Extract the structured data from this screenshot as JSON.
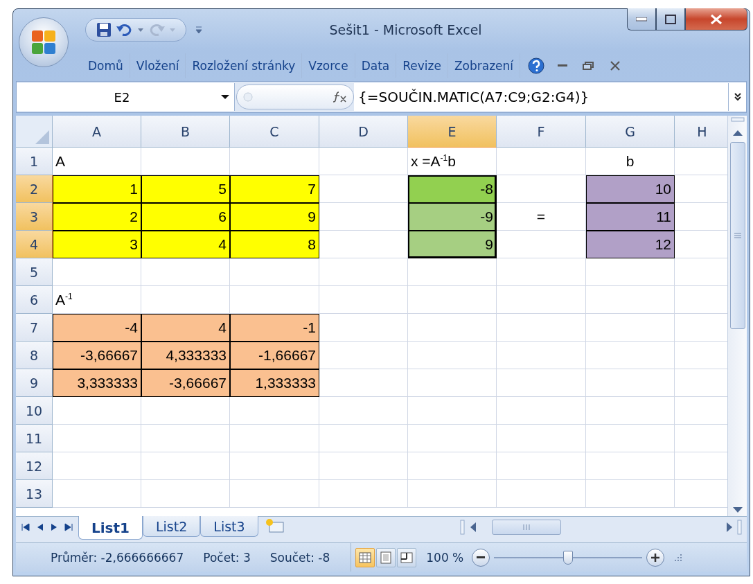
{
  "window": {
    "title": "Sešit1  -  Microsoft Excel"
  },
  "ribbon_tabs": [
    "Domů",
    "Vložení",
    "Rozložení stránky",
    "Vzorce",
    "Data",
    "Revize",
    "Zobrazení"
  ],
  "formula_bar": {
    "name_box": "E2",
    "formula": "{=SOUČIN.MATIC(A7:C9;G2:G4)}"
  },
  "columns": [
    {
      "label": "A",
      "selected": false
    },
    {
      "label": "B",
      "selected": false
    },
    {
      "label": "C",
      "selected": false
    },
    {
      "label": "D",
      "selected": false
    },
    {
      "label": "E",
      "selected": true
    },
    {
      "label": "F",
      "selected": false
    },
    {
      "label": "G",
      "selected": false
    },
    {
      "label": "H",
      "selected": false
    }
  ],
  "rows": [
    {
      "label": "1",
      "selected": false,
      "cells": [
        {
          "text": "A",
          "kind": "text"
        },
        null,
        null,
        null,
        {
          "text": "x =A$^{-1}$b",
          "kind": "text"
        },
        null,
        {
          "text": "b",
          "kind": "centered"
        },
        null
      ]
    },
    {
      "label": "2",
      "selected": true,
      "cells": [
        {
          "text": "1",
          "kind": "number",
          "color": "#ffff00"
        },
        {
          "text": "5",
          "kind": "number",
          "color": "#ffff00"
        },
        {
          "text": "7",
          "kind": "number",
          "color": "#ffff00"
        },
        null,
        {
          "text": "-8",
          "kind": "number",
          "color": "#92d050"
        },
        null,
        {
          "text": "10",
          "kind": "number",
          "color": "#b1a0c7"
        },
        null
      ]
    },
    {
      "label": "3",
      "selected": true,
      "cells": [
        {
          "text": "2",
          "kind": "number",
          "color": "#ffff00"
        },
        {
          "text": "6",
          "kind": "number",
          "color": "#ffff00"
        },
        {
          "text": "9",
          "kind": "number",
          "color": "#ffff00"
        },
        null,
        {
          "text": "-9",
          "kind": "number",
          "color": "#a6cf82"
        },
        {
          "text": "=",
          "kind": "centered"
        },
        {
          "text": "11",
          "kind": "number",
          "color": "#b1a0c7"
        },
        null
      ]
    },
    {
      "label": "4",
      "selected": true,
      "cells": [
        {
          "text": "3",
          "kind": "number",
          "color": "#ffff00"
        },
        {
          "text": "4",
          "kind": "number",
          "color": "#ffff00"
        },
        {
          "text": "8",
          "kind": "number",
          "color": "#ffff00"
        },
        null,
        {
          "text": "9",
          "kind": "number",
          "color": "#a6cf82"
        },
        null,
        {
          "text": "12",
          "kind": "number",
          "color": "#b1a0c7"
        },
        null
      ]
    },
    {
      "label": "5",
      "selected": false,
      "cells": [
        null,
        null,
        null,
        null,
        null,
        null,
        null,
        null
      ]
    },
    {
      "label": "6",
      "selected": false,
      "cells": [
        {
          "text": "A$^{-1}$",
          "kind": "text"
        },
        null,
        null,
        null,
        null,
        null,
        null,
        null
      ]
    },
    {
      "label": "7",
      "selected": false,
      "cells": [
        {
          "text": "-4",
          "kind": "number",
          "color": "#fac090"
        },
        {
          "text": "4",
          "kind": "number",
          "color": "#fac090"
        },
        {
          "text": "-1",
          "kind": "number",
          "color": "#fac090"
        },
        null,
        null,
        null,
        null,
        null
      ]
    },
    {
      "label": "8",
      "selected": false,
      "cells": [
        {
          "text": "-3,66667",
          "kind": "number",
          "color": "#fac090"
        },
        {
          "text": "4,333333",
          "kind": "number",
          "color": "#fac090"
        },
        {
          "text": "-1,66667",
          "kind": "number",
          "color": "#fac090"
        },
        null,
        null,
        null,
        null,
        null
      ]
    },
    {
      "label": "9",
      "selected": false,
      "cells": [
        {
          "text": "3,333333",
          "kind": "number",
          "color": "#fac090"
        },
        {
          "text": "-3,66667",
          "kind": "number",
          "color": "#fac090"
        },
        {
          "text": "1,333333",
          "kind": "number",
          "color": "#fac090"
        },
        null,
        null,
        null,
        null,
        null
      ]
    },
    {
      "label": "10",
      "selected": false,
      "cells": [
        null,
        null,
        null,
        null,
        null,
        null,
        null,
        null
      ]
    },
    {
      "label": "11",
      "selected": false,
      "cells": [
        null,
        null,
        null,
        null,
        null,
        null,
        null,
        null
      ]
    },
    {
      "label": "12",
      "selected": false,
      "cells": [
        null,
        null,
        null,
        null,
        null,
        null,
        null,
        null
      ]
    },
    {
      "label": "13",
      "selected": false,
      "cells": [
        null,
        null,
        null,
        null,
        null,
        null,
        null,
        null
      ]
    }
  ],
  "sheet_tabs": [
    {
      "label": "List1",
      "selected": true
    },
    {
      "label": "List2",
      "selected": false
    },
    {
      "label": "List3",
      "selected": false
    }
  ],
  "status_bar": {
    "items": [
      "Průměr: -2,666666667",
      "Počet: 3",
      "Součet: -8"
    ],
    "views": [
      {
        "kind": "normal",
        "selected": true
      },
      {
        "kind": "layout",
        "selected": false
      },
      {
        "kind": "pagebreak",
        "selected": false
      }
    ],
    "zoom": "100 %",
    "zoom_slider": {
      "level": 0.5
    }
  }
}
